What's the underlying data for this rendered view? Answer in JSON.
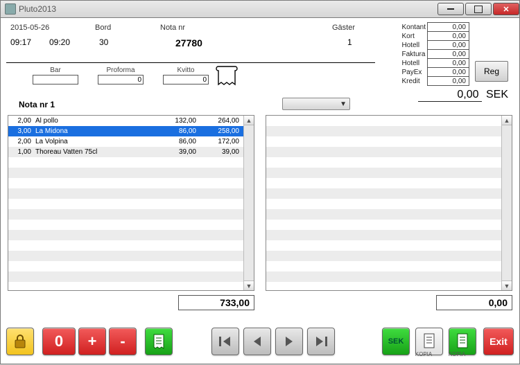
{
  "window": {
    "title": "Pluto2013"
  },
  "header": {
    "date_label": "",
    "date": "2015-05-26",
    "bord_label": "Bord",
    "notanr_label": "Nota nr",
    "gaster_label": "Gäster",
    "time1": "09:17",
    "time2": "09:20",
    "bord": "30",
    "notanr": "27780",
    "gaster": "1",
    "bar_label": "Bar",
    "proforma_label": "Proforma",
    "kvitto_label": "Kvitto",
    "proforma_value": "0",
    "kvitto_value": "0"
  },
  "payments": [
    {
      "label": "Kontant",
      "value": "0,00"
    },
    {
      "label": "Kort",
      "value": "0,00"
    },
    {
      "label": "Hotell",
      "value": "0,00"
    },
    {
      "label": "Faktura",
      "value": "0,00"
    },
    {
      "label": "Hotell",
      "value": "0,00"
    },
    {
      "label": "PayEx",
      "value": "0,00"
    },
    {
      "label": "Kredit",
      "value": "0,00"
    }
  ],
  "reg_label": "Reg",
  "grand_total": {
    "value": "0,00",
    "currency": "SEK"
  },
  "nota_title": "Nota nr 1",
  "left_items": [
    {
      "qty": "2,00",
      "name": "Al pollo",
      "unit": "132,00",
      "line": "264,00",
      "selected": false
    },
    {
      "qty": "3,00",
      "name": "La Midona",
      "unit": "86,00",
      "line": "258,00",
      "selected": true
    },
    {
      "qty": "2,00",
      "name": "La Volpina",
      "unit": "86,00",
      "line": "172,00",
      "selected": false
    },
    {
      "qty": "1,00",
      "name": "Thoreau Vatten 75cl",
      "unit": "39,00",
      "line": "39,00",
      "selected": false
    }
  ],
  "left_sum": "733,00",
  "right_sum": "0,00",
  "buttons": {
    "lock": "lock",
    "zero": "0",
    "plus": "+",
    "minus": "-",
    "sek": "SEK",
    "exit": "Exit",
    "kopia": "KOPIA"
  }
}
